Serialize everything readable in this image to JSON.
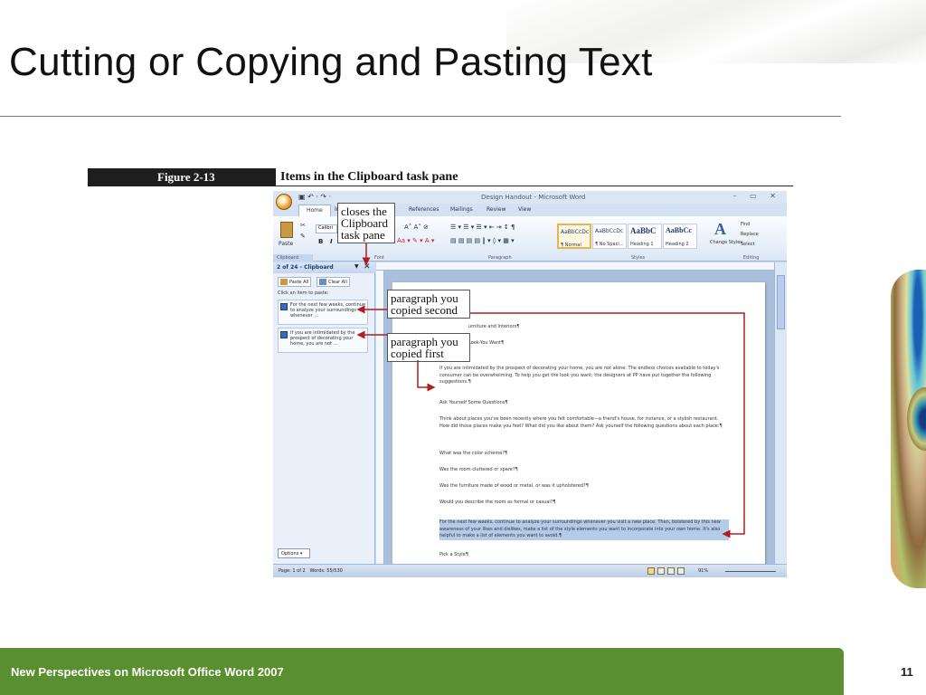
{
  "slide": {
    "title": "Cutting or Copying and Pasting Text",
    "footer": "New Perspectives on Microsoft Office Word 2007",
    "page_number": "11"
  },
  "figure": {
    "label": "Figure 2-13",
    "caption": "Items in the Clipboard task pane"
  },
  "callouts": {
    "closes": "closes the Clipboard task pane",
    "second": "paragraph you copied second",
    "first": "paragraph you copied first"
  },
  "word": {
    "window_title": "Design Handout - Microsoft Word",
    "window_controls": "– ▭ ✕",
    "qat": "▣ ↶ · ↷ ·",
    "tabs": [
      "Home",
      "In",
      "References",
      "Mailings",
      "Review",
      "View"
    ],
    "ribbon": {
      "paste_label": "Paste",
      "font_name": "Calibri",
      "clipboard_group": "Clipboard",
      "font_group": "Font",
      "paragraph_group": "Paragraph",
      "styles_group": "Styles",
      "editing_group": "Editing",
      "styles": [
        {
          "preview": "AaBbCcDc",
          "name": "¶ Normal"
        },
        {
          "preview": "AaBbCcDc",
          "name": "¶ No Spaci..."
        },
        {
          "preview": "AaBbC",
          "name": "Heading 1"
        },
        {
          "preview": "AaBbCc",
          "name": "Heading 2"
        }
      ],
      "change_styles": "Change Styles",
      "editing": [
        "Find",
        "Replace",
        "Select"
      ]
    },
    "clipboard_pane": {
      "title": "2 of 24 - Clipboard",
      "paste_all": "Paste All",
      "clear_all": "Clear All",
      "hint": "Click an item to paste:",
      "items": [
        "For the next few weeks, continue to analyze your surroundings whenever ...",
        "If you are intimidated by the prospect of decorating your home, you are not ..."
      ],
      "options": "Options ▾"
    },
    "document": {
      "paragraphs": [
        "urniture and Interiors¶",
        "Look-You Want¶",
        "If you are intimidated by the prospect of decorating your home, you are not alone. The endless choices available to today's consumer can be overwhelming. To help you get the look you want, the designers at PP have put together the following suggestions.¶",
        "Ask Yourself Some Questions¶",
        "Think about places you've been recently where you felt comfortable—a friend's house, for instance, or a stylish restaurant. How did those places make you feel? What did you like about them? Ask yourself the following questions about each place:¶",
        "What was the color scheme?¶",
        "Was the room cluttered or spare?¶",
        "Was the furniture made of wood or metal, or was it upholstered?¶",
        "Would you describe the room as formal or casual?¶",
        "For the next few weeks, continue to analyze your surroundings whenever you visit a new place. Then, bolstered by this new awareness of your likes and dislikes, make a list of the style elements you want to incorporate into your own home. It's also helpful to make a list of elements you want to avoid.¶",
        "Pick a Style¶"
      ]
    },
    "status": {
      "page": "Page: 1 of 2",
      "words": "Words: 55/530",
      "zoom": "91%"
    }
  }
}
